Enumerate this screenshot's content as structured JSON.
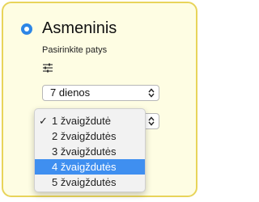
{
  "option": {
    "title": "Asmeninis",
    "subtitle": "Pasirinkite patys",
    "selected": true
  },
  "period_select": {
    "value": "7 dienos"
  },
  "rating_select": {
    "options": [
      {
        "label": "1 žvaigždutė",
        "checked": true
      },
      {
        "label": "2 žvaigždutės",
        "checked": false
      },
      {
        "label": "3 žvaigždutės",
        "checked": false
      },
      {
        "label": "4 žvaigždutės",
        "checked": false,
        "highlighted": true
      },
      {
        "label": "5 žvaigždutės",
        "checked": false
      }
    ],
    "check_mark": "✓"
  },
  "icons": {
    "radio": "radio-selected-icon",
    "filter": "sliders-icon",
    "arrows": "up-down-arrows-icon"
  },
  "colors": {
    "card_background": "#fefde3",
    "card_border": "#e8d45a",
    "accent": "#2d86e6",
    "highlight": "#3f8ff0"
  }
}
